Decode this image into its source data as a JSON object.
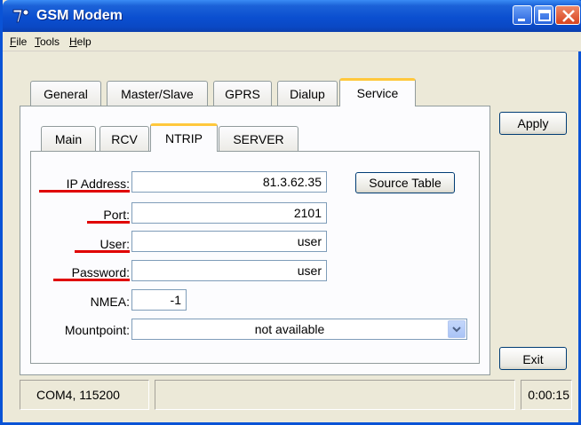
{
  "window": {
    "title": "GSM Modem"
  },
  "menu": [
    {
      "label": "File",
      "accel": "F",
      "rest": "ile"
    },
    {
      "label": "Tools",
      "accel": "T",
      "rest": "ools"
    },
    {
      "label": "Help",
      "accel": "H",
      "rest": "elp"
    }
  ],
  "outer_tabs": [
    "General",
    "Master/Slave",
    "GPRS",
    "Dialup",
    "Service"
  ],
  "outer_active": "Service",
  "inner_tabs": [
    "Main",
    "RCV",
    "NTRIP",
    "SERVER"
  ],
  "inner_active": "NTRIP",
  "form": {
    "ip_label": "IP Address:",
    "ip_value": "81.3.62.35",
    "port_label": "Port:",
    "port_value": "2101",
    "user_label": "User:",
    "user_value": "user",
    "password_label": "Password:",
    "password_value": "user",
    "nmea_label": "NMEA:",
    "nmea_value": "-1",
    "mountpoint_label": "Mountpoint:",
    "mountpoint_value": "not available",
    "source_table_label": "Source Table"
  },
  "buttons": {
    "apply": "Apply",
    "exit": "Exit"
  },
  "status": {
    "port": "COM4, 115200",
    "message": "",
    "time": "0:00:15"
  },
  "colors": {
    "title_bar": "#0a48c4",
    "active_tab_accent": "#ffc83c",
    "highlight_underline": "#e00000"
  }
}
